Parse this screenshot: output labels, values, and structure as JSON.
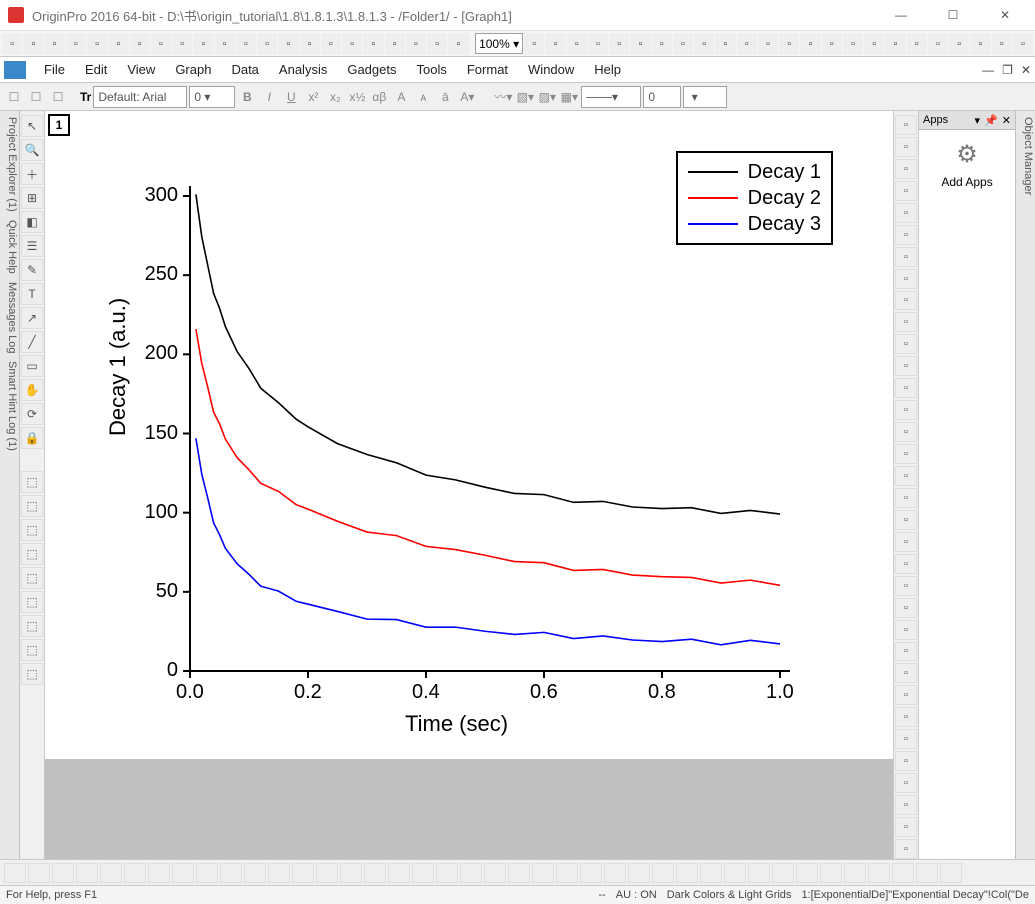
{
  "window": {
    "title": "OriginPro 2016 64-bit - D:\\书\\origin_tutorial\\1.8\\1.8.1.3\\1.8.1.3 - /Folder1/ - [Graph1]"
  },
  "menubar": [
    "File",
    "Edit",
    "View",
    "Graph",
    "Data",
    "Analysis",
    "Gadgets",
    "Tools",
    "Format",
    "Window",
    "Help"
  ],
  "toolbar": {
    "zoom": "100%"
  },
  "formatbar": {
    "font_label": "Default: Arial",
    "font_size": "0",
    "opacity": "0"
  },
  "left_panes": [
    "Project Explorer (1)",
    "Quick Help",
    "Messages Log",
    "Smart Hint Log (1)"
  ],
  "right_pane": "Object Manager",
  "apps_panel": {
    "title": "Apps",
    "add": "Add Apps"
  },
  "graph": {
    "layer": "1",
    "xlabel": "Time (sec)",
    "ylabel": "Decay 1 (a.u.)",
    "legend": [
      "Decay 1",
      "Decay 2",
      "Decay 3"
    ]
  },
  "status": {
    "help": "For Help, press F1",
    "dash": "--",
    "au": "AU : ON",
    "colors": "Dark Colors & Light Grids",
    "sel": "1:[ExponentialDe]\"Exponential Decay\"!Col(\"De"
  },
  "chart_data": {
    "type": "line",
    "xlabel": "Time (sec)",
    "ylabel": "Decay 1 (a.u.)",
    "xlim": [
      0.0,
      1.0
    ],
    "ylim": [
      0,
      300
    ],
    "xticks": [
      0.0,
      0.2,
      0.4,
      0.6,
      0.8,
      1.0
    ],
    "yticks": [
      0,
      50,
      100,
      150,
      200,
      250,
      300
    ],
    "x": [
      0.01,
      0.02,
      0.03,
      0.04,
      0.05,
      0.06,
      0.08,
      0.1,
      0.12,
      0.15,
      0.18,
      0.2,
      0.25,
      0.3,
      0.35,
      0.4,
      0.45,
      0.5,
      0.55,
      0.6,
      0.65,
      0.7,
      0.75,
      0.8,
      0.85,
      0.9,
      0.95,
      1.0
    ],
    "series": [
      {
        "name": "Decay 1",
        "color": "#000000",
        "values": [
          301,
          275,
          255,
          240,
          228,
          218,
          202,
          190,
          180,
          168,
          160,
          154,
          143,
          138,
          130,
          125,
          120,
          116,
          113,
          110,
          108,
          106,
          104,
          103,
          102,
          101,
          100,
          100
        ]
      },
      {
        "name": "Decay 2",
        "color": "#ff0000",
        "values": [
          216,
          195,
          178,
          165,
          155,
          147,
          135,
          126,
          120,
          112,
          106,
          102,
          94,
          89,
          84,
          80,
          76,
          73,
          70,
          67,
          65,
          63,
          61,
          60,
          58,
          57,
          56,
          55
        ]
      },
      {
        "name": "Decay 3",
        "color": "#0000ff",
        "values": [
          147,
          125,
          108,
          95,
          85,
          78,
          68,
          60,
          55,
          49,
          45,
          42,
          37,
          34,
          31,
          29,
          27,
          25,
          24,
          23,
          22,
          21,
          20,
          19,
          19,
          18,
          18,
          18
        ]
      }
    ]
  }
}
